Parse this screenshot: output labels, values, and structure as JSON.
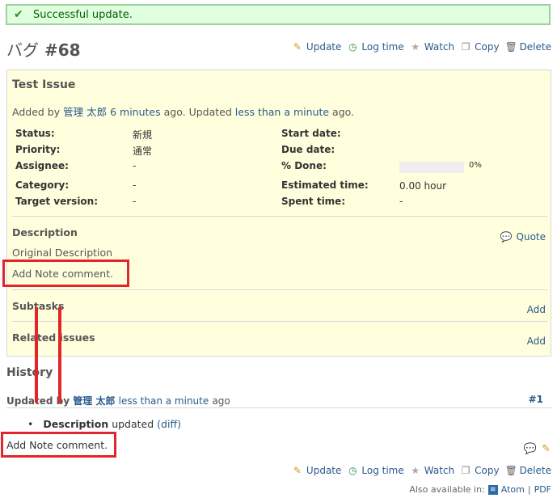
{
  "flash": {
    "message": "Successful update."
  },
  "issue": {
    "tracker_title": "バグ",
    "number": "#68",
    "subject": "Test Issue",
    "added_by_prefix": "Added by",
    "author": "管理 太郎",
    "created_ago": "6 minutes",
    "ago_updated": "ago. Updated",
    "updated_ago": "less than a minute",
    "ago_end": "ago.",
    "attributes_left": [
      {
        "label": "Status:",
        "value": "新規"
      },
      {
        "label": "Priority:",
        "value": "通常"
      },
      {
        "label": "Assignee:",
        "value": "-"
      },
      {
        "label": "Category:",
        "value": "-"
      },
      {
        "label": "Target version:",
        "value": "-"
      }
    ],
    "attributes_right": [
      {
        "label": "Start date:",
        "value": ""
      },
      {
        "label": "Due date:",
        "value": ""
      },
      {
        "label": "% Done:",
        "value": "0%"
      },
      {
        "label": "Estimated time:",
        "value": "0.00 hour"
      },
      {
        "label": "Spent time:",
        "value": "-"
      }
    ],
    "done_ratio": 0,
    "description_label": "Description",
    "quote_label": "Quote",
    "description_lines": [
      "Original Description",
      "Add Note comment."
    ],
    "subtasks_label": "Subtasks",
    "related_label": "Related issues",
    "add_label": "Add"
  },
  "actions": {
    "update": "Update",
    "log_time": "Log time",
    "watch": "Watch",
    "copy": "Copy",
    "delete": "Delete"
  },
  "history": {
    "title": "History",
    "updated_by": "Updated by",
    "author": "管理 太郎",
    "when": "less than a minute",
    "ago": "ago",
    "number": "#1",
    "detail_field": "Description",
    "detail_text": "updated",
    "diff_label": "(diff)",
    "note": "Add Note comment."
  },
  "footer": {
    "also_available": "Also available in:",
    "atom": "Atom",
    "separator": "|",
    "pdf": "PDF"
  },
  "colors": {
    "flash_bg": "#dfffdf",
    "issue_bg": "#ffffdd",
    "link": "#2a5a8c",
    "annotation_red": "#e2242b"
  }
}
